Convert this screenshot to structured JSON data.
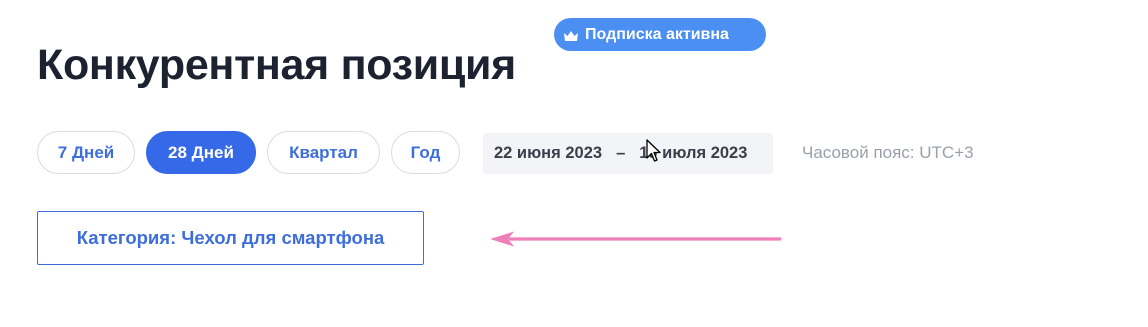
{
  "header": {
    "title": "Конкурентная позиция",
    "badge": {
      "icon": "crown-icon",
      "label": "Подписка активна",
      "color": "#4b8ff2"
    }
  },
  "filters": {
    "periods": [
      {
        "label": "7 Дней",
        "active": false
      },
      {
        "label": "28 Дней",
        "active": true
      },
      {
        "label": "Квартал",
        "active": false
      },
      {
        "label": "Год",
        "active": false
      }
    ],
    "date_range": {
      "start": "22 июня 2023",
      "separator": "–",
      "end": "19 июля 2023"
    },
    "timezone": "Часовой пояс: UTC+3"
  },
  "category": {
    "label": "Категория: Чехол для смартфона"
  },
  "colors": {
    "accent": "#3569e8",
    "link": "#3e6edc",
    "annotation_arrow": "#ef7fb8"
  }
}
